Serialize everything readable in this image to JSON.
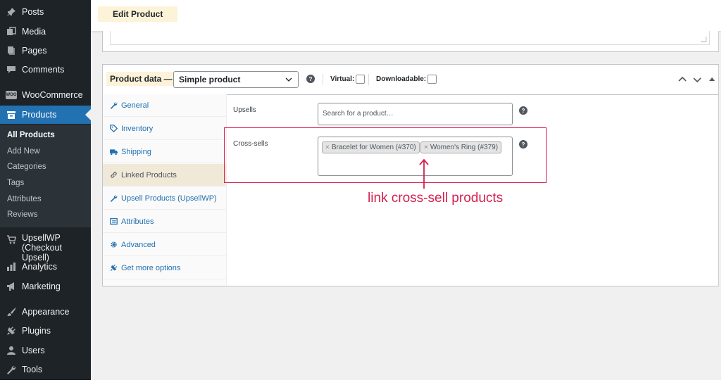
{
  "sidebar": {
    "items": [
      {
        "label": "Posts",
        "icon": "pushpin-icon"
      },
      {
        "label": "Media",
        "icon": "media-icon"
      },
      {
        "label": "Pages",
        "icon": "pages-icon"
      },
      {
        "label": "Comments",
        "icon": "comment-icon"
      },
      {
        "label": "WooCommerce",
        "icon": "woocommerce-icon",
        "badge": "WOO"
      },
      {
        "label": "Products",
        "icon": "archive-icon",
        "active": true
      },
      {
        "label": "UpsellWP",
        "label2": "(Checkout Upsell)",
        "icon": "cart-icon"
      },
      {
        "label": "Analytics",
        "icon": "bar-chart-icon"
      },
      {
        "label": "Marketing",
        "icon": "megaphone-icon"
      },
      {
        "label": "Appearance",
        "icon": "brush-icon"
      },
      {
        "label": "Plugins",
        "icon": "plug-icon"
      },
      {
        "label": "Users",
        "icon": "user-icon"
      },
      {
        "label": "Tools",
        "icon": "wrench-icon"
      }
    ],
    "submenu": [
      "All Products",
      "Add New",
      "Categories",
      "Tags",
      "Attributes",
      "Reviews"
    ],
    "submenu_current": "All Products"
  },
  "header": {
    "title": "Edit Product"
  },
  "product_data": {
    "label": "Product data —",
    "type_selected": "Simple product",
    "help": "?",
    "virtual_label": "Virtual:",
    "downloadable_label": "Downloadable:"
  },
  "tabs": [
    {
      "label": "General",
      "icon": "wrench-icon"
    },
    {
      "label": "Inventory",
      "icon": "tag-icon"
    },
    {
      "label": "Shipping",
      "icon": "truck-icon"
    },
    {
      "label": "Linked Products",
      "icon": "link-icon",
      "active": true
    },
    {
      "label": "Upsell Products (UpsellWP)",
      "icon": "wrench-icon"
    },
    {
      "label": "Attributes",
      "icon": "list-icon"
    },
    {
      "label": "Advanced",
      "icon": "gear-icon"
    },
    {
      "label": "Get more options",
      "icon": "plug-icon"
    }
  ],
  "linked": {
    "upsells_label": "Upsells",
    "upsells_placeholder": "Search for a product…",
    "crosssells_label": "Cross-sells",
    "tokens": [
      {
        "x": "×",
        "label": "Bracelet for Women (#370)"
      },
      {
        "x": "×",
        "label": "Women's Ring (#379)"
      }
    ]
  },
  "annotation": {
    "text": "link cross-sell products"
  },
  "colors": {
    "sidebar": "#1d2327",
    "active": "#2271b1",
    "link": "#2271b1",
    "annotation": "#d41f4f",
    "highlight": "#fdf3d8"
  }
}
